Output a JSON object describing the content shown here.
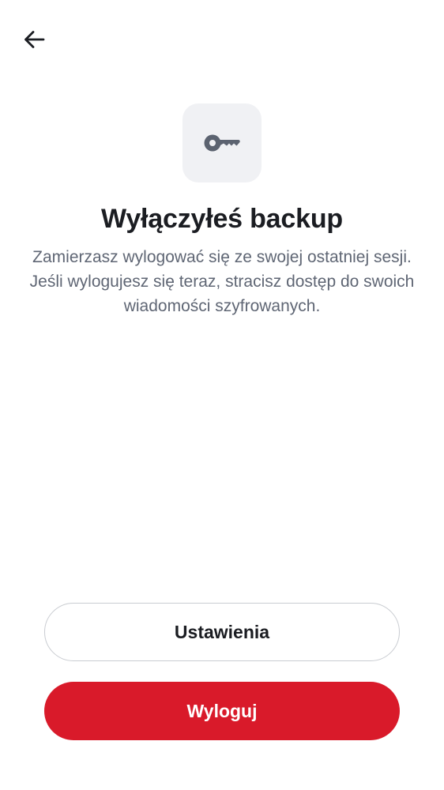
{
  "header": {
    "back_icon": "arrow-left-icon"
  },
  "hero": {
    "icon": "key-icon",
    "title": "Wyłączyłeś backup",
    "description": "Zamierzasz wylogować się ze swojej ostatniej sesji. Jeśli wylogujesz się teraz, stracisz dostęp do swoich wiadomości szyfrowanych."
  },
  "actions": {
    "settings_label": "Ustawienia",
    "logout_label": "Wyloguj"
  },
  "colors": {
    "primary": "#d91a2a",
    "icon_tile_bg": "#f0f1f4",
    "icon": "#5c6370",
    "text_primary": "#1b1d22",
    "text_secondary": "#5f6674"
  }
}
